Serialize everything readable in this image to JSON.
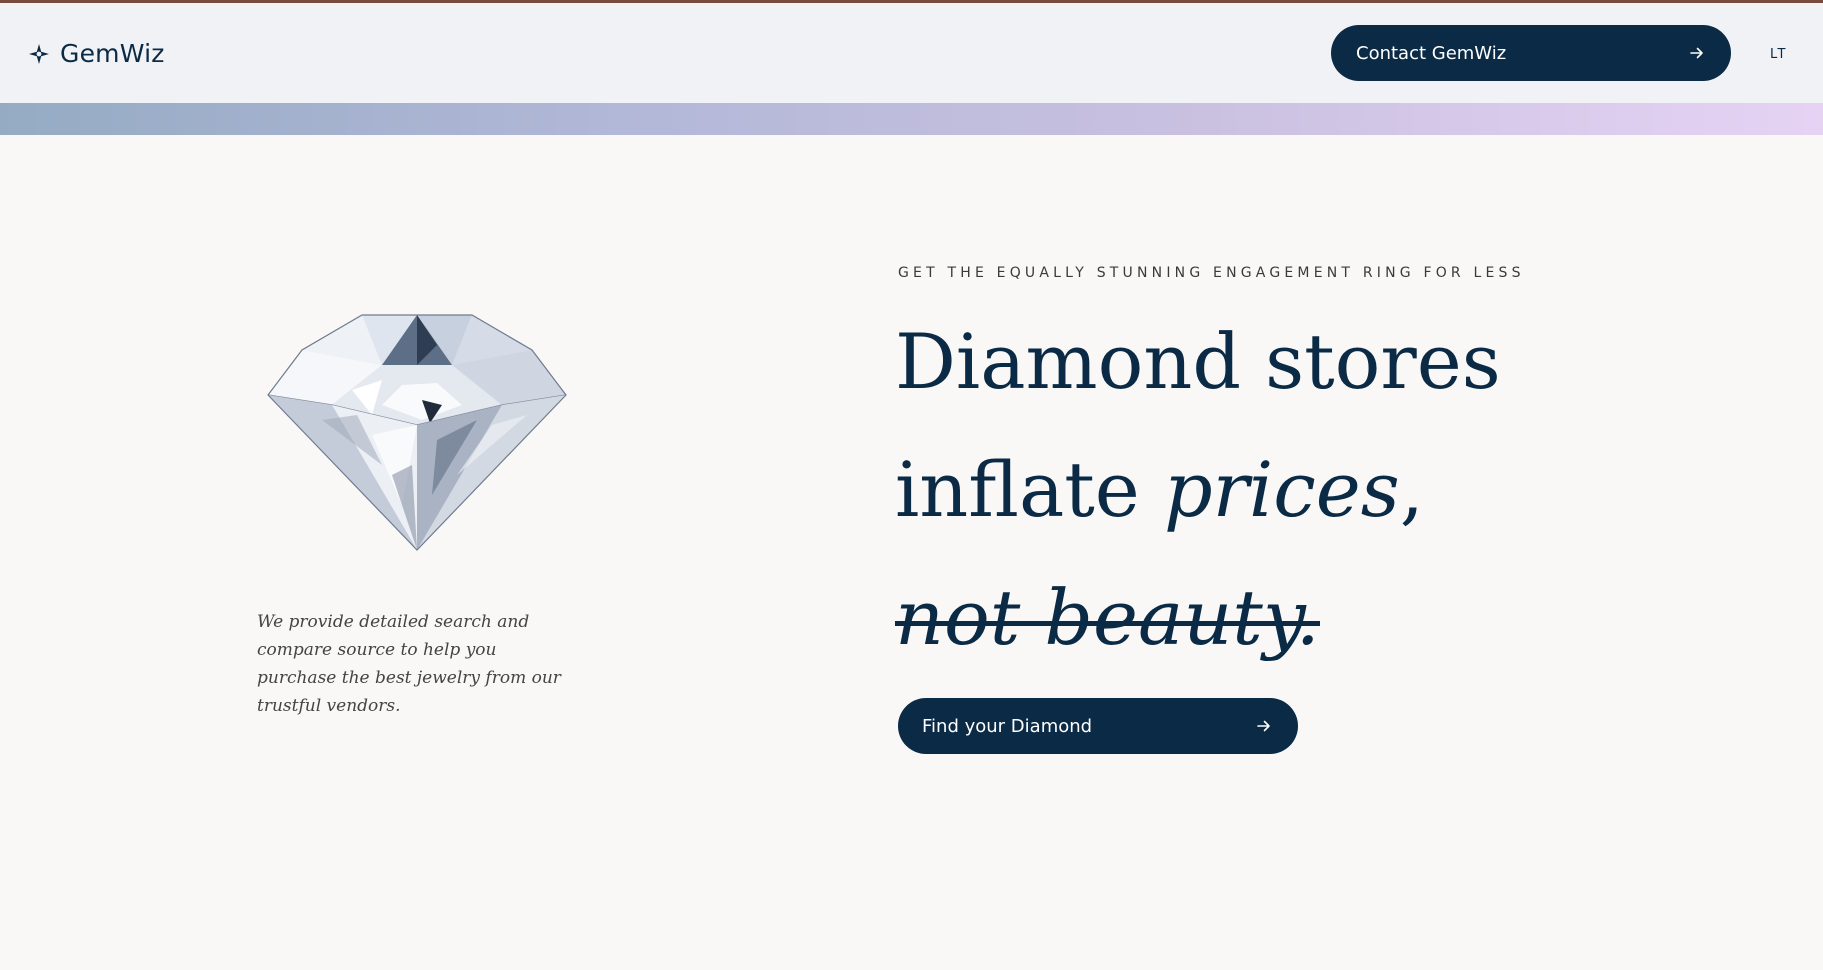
{
  "colors": {
    "brand_navy": "#0b2a45",
    "page_background": "#f9f8f6",
    "header_background": "#f1f2f5",
    "gradient_start": "#95abc4",
    "gradient_end": "#e6d3f4"
  },
  "header": {
    "logo_icon": "sparkle-icon",
    "logo_text": "GemWiz",
    "contact_button": {
      "label": "Contact GemWiz",
      "icon": "arrow-right-icon"
    },
    "language": "LT"
  },
  "hero": {
    "image": "diamond-image",
    "description": "We provide detailed search and compare source to help you purchase the best jewelry from our trustful vendors.",
    "eyebrow": "GET THE EQUALLY STUNNING ENGAGEMENT RING FOR LESS",
    "headline": {
      "line1": "Diamond stores",
      "line2_plain": "inflate ",
      "line2_italic": "prices",
      "line2_end": ",",
      "line3_struck": "not beauty."
    },
    "cta_button": {
      "label": "Find your Diamond",
      "icon": "arrow-right-icon"
    }
  }
}
